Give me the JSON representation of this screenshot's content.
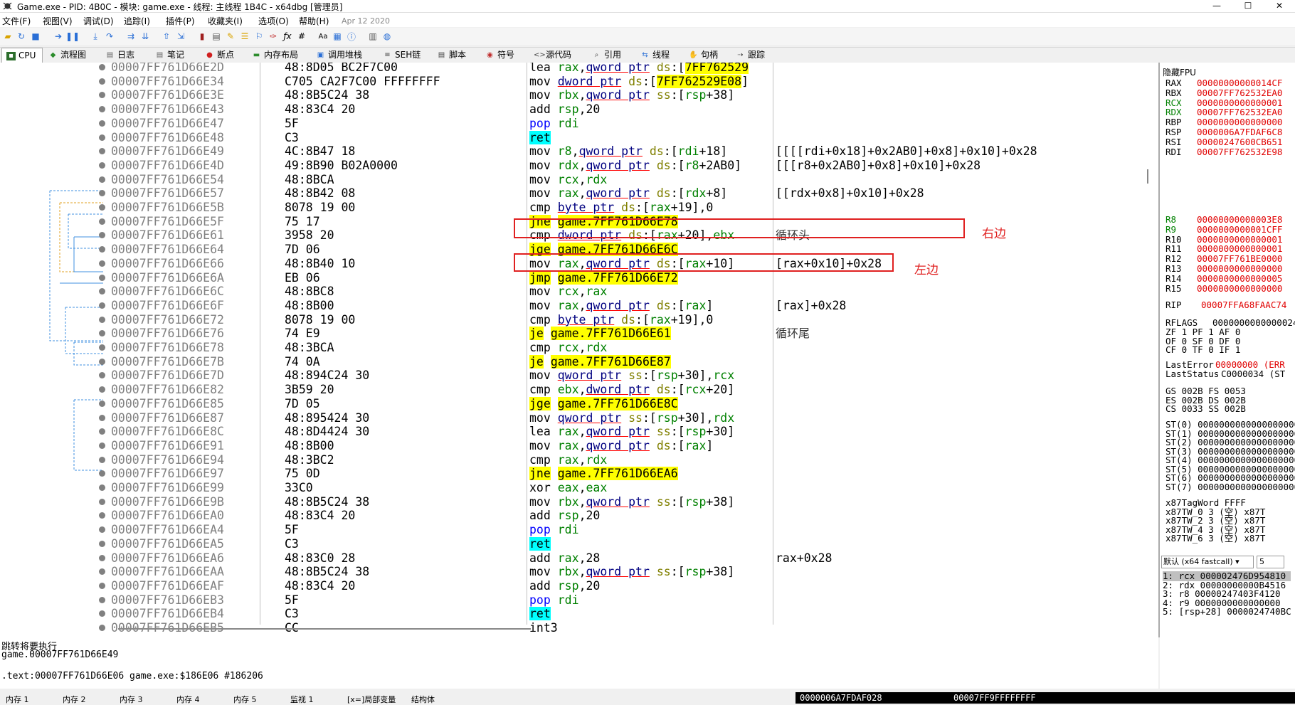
{
  "window": {
    "title": "Game.exe - PID: 4B0C - 模块: game.exe - 线程: 主线程 1B4C - x64dbg [管理员]",
    "min": "—",
    "max": "☐",
    "close": "✕"
  },
  "menu": {
    "items": [
      "文件(F)",
      "视图(V)",
      "调试(D)",
      "追踪(I)",
      "插件(P)",
      "收藏夹(I)",
      "选项(O)",
      "帮助(H)"
    ],
    "date": "Apr 12 2020"
  },
  "tabs": [
    {
      "label": "CPU",
      "icon": "cpu-icon"
    },
    {
      "label": "流程图",
      "icon": "graph-icon"
    },
    {
      "label": "日志",
      "icon": "log-icon"
    },
    {
      "label": "笔记",
      "icon": "notes-icon"
    },
    {
      "label": "断点",
      "icon": "breakpoint-icon"
    },
    {
      "label": "内存布局",
      "icon": "memory-map-icon"
    },
    {
      "label": "调用堆栈",
      "icon": "callstack-icon"
    },
    {
      "label": "SEH链",
      "icon": "seh-icon"
    },
    {
      "label": "脚本",
      "icon": "script-icon"
    },
    {
      "label": "符号",
      "icon": "symbol-icon"
    },
    {
      "label": "源代码",
      "icon": "source-icon"
    },
    {
      "label": "引用",
      "icon": "references-icon"
    },
    {
      "label": "线程",
      "icon": "threads-icon"
    },
    {
      "label": "句柄",
      "icon": "handles-icon"
    },
    {
      "label": "跟踪",
      "icon": "trace-icon"
    }
  ],
  "disasm": [
    {
      "addr": "00007FF761D66E2D",
      "bytes": "48:8D05 BC2F7C00",
      "mn": "lea",
      "ops": "rax,qword ptr ds:[7FF762529",
      "cmt": ""
    },
    {
      "addr": "00007FF761D66E34",
      "bytes": "C705 CA2F7C00 FFFFFFFF",
      "mn": "mov",
      "ops": "dword ptr ds:[7FF762529E08]",
      "cmt": ""
    },
    {
      "addr": "00007FF761D66E3E",
      "bytes": "48:8B5C24 38",
      "mn": "mov",
      "ops": "rbx,qword ptr ss:[rsp+38]",
      "cmt": ""
    },
    {
      "addr": "00007FF761D66E43",
      "bytes": "48:83C4 20",
      "mn": "add",
      "ops": "rsp,20",
      "cmt": ""
    },
    {
      "addr": "00007FF761D66E47",
      "bytes": "5F",
      "mn": "pop",
      "ops": "rdi",
      "cmt": ""
    },
    {
      "addr": "00007FF761D66E48",
      "bytes": "C3",
      "mn": "ret",
      "ops": "",
      "cmt": ""
    },
    {
      "addr": "00007FF761D66E49",
      "bytes": "4C:8B47 18",
      "mn": "mov",
      "ops": "r8,qword ptr ds:[rdi+18]",
      "cmt": "[[[[rdi+0x18]+0x2AB0]+0x8]+0x10]+0x28"
    },
    {
      "addr": "00007FF761D66E4D",
      "bytes": "49:8B90 B02A0000",
      "mn": "mov",
      "ops": "rdx,qword ptr ds:[r8+2AB0]",
      "cmt": "[[[r8+0x2AB0]+0x8]+0x10]+0x28"
    },
    {
      "addr": "00007FF761D66E54",
      "bytes": "48:8BCA",
      "mn": "mov",
      "ops": "rcx,rdx",
      "cmt": ""
    },
    {
      "addr": "00007FF761D66E57",
      "bytes": "48:8B42 08",
      "mn": "mov",
      "ops": "rax,qword ptr ds:[rdx+8]",
      "cmt": "[[rdx+0x8]+0x10]+0x28"
    },
    {
      "addr": "00007FF761D66E5B",
      "bytes": "8078 19 00",
      "mn": "cmp",
      "ops": "byte ptr ds:[rax+19],0",
      "cmt": ""
    },
    {
      "addr": "00007FF761D66E5F",
      "bytes": "75 17",
      "mn": "jne",
      "ops": "game.7FF761D66E78",
      "cmt": ""
    },
    {
      "addr": "00007FF761D66E61",
      "bytes": "3958 20",
      "mn": "cmp",
      "ops": "dword ptr ds:[rax+20],ebx",
      "cmt": "循环头"
    },
    {
      "addr": "00007FF761D66E64",
      "bytes": "7D 06",
      "mn": "jge",
      "ops": "game.7FF761D66E6C",
      "cmt": ""
    },
    {
      "addr": "00007FF761D66E66",
      "bytes": "48:8B40 10",
      "mn": "mov",
      "ops": "rax,qword ptr ds:[rax+10]",
      "cmt": "[rax+0x10]+0x28"
    },
    {
      "addr": "00007FF761D66E6A",
      "bytes": "EB 06",
      "mn": "jmp",
      "ops": "game.7FF761D66E72",
      "cmt": ""
    },
    {
      "addr": "00007FF761D66E6C",
      "bytes": "48:8BC8",
      "mn": "mov",
      "ops": "rcx,rax",
      "cmt": ""
    },
    {
      "addr": "00007FF761D66E6F",
      "bytes": "48:8B00",
      "mn": "mov",
      "ops": "rax,qword ptr ds:[rax]",
      "cmt": "[rax]+0x28"
    },
    {
      "addr": "00007FF761D66E72",
      "bytes": "8078 19 00",
      "mn": "cmp",
      "ops": "byte ptr ds:[rax+19],0",
      "cmt": ""
    },
    {
      "addr": "00007FF761D66E76",
      "bytes": "74 E9",
      "mn": "je",
      "ops": "game.7FF761D66E61",
      "cmt": "循环尾"
    },
    {
      "addr": "00007FF761D66E78",
      "bytes": "48:3BCA",
      "mn": "cmp",
      "ops": "rcx,rdx",
      "cmt": ""
    },
    {
      "addr": "00007FF761D66E7B",
      "bytes": "74 0A",
      "mn": "je",
      "ops": "game.7FF761D66E87",
      "cmt": ""
    },
    {
      "addr": "00007FF761D66E7D",
      "bytes": "48:894C24 30",
      "mn": "mov",
      "ops": "qword ptr ss:[rsp+30],rcx",
      "cmt": ""
    },
    {
      "addr": "00007FF761D66E82",
      "bytes": "3B59 20",
      "mn": "cmp",
      "ops": "ebx,dword ptr ds:[rcx+20]",
      "cmt": ""
    },
    {
      "addr": "00007FF761D66E85",
      "bytes": "7D 05",
      "mn": "jge",
      "ops": "game.7FF761D66E8C",
      "cmt": ""
    },
    {
      "addr": "00007FF761D66E87",
      "bytes": "48:895424 30",
      "mn": "mov",
      "ops": "qword ptr ss:[rsp+30],rdx",
      "cmt": ""
    },
    {
      "addr": "00007FF761D66E8C",
      "bytes": "48:8D4424 30",
      "mn": "lea",
      "ops": "rax,qword ptr ss:[rsp+30]",
      "cmt": ""
    },
    {
      "addr": "00007FF761D66E91",
      "bytes": "48:8B00",
      "mn": "mov",
      "ops": "rax,qword ptr ds:[rax]",
      "cmt": ""
    },
    {
      "addr": "00007FF761D66E94",
      "bytes": "48:3BC2",
      "mn": "cmp",
      "ops": "rax,rdx",
      "cmt": ""
    },
    {
      "addr": "00007FF761D66E97",
      "bytes": "75 0D",
      "mn": "jne",
      "ops": "game.7FF761D66EA6",
      "cmt": ""
    },
    {
      "addr": "00007FF761D66E99",
      "bytes": "33C0",
      "mn": "xor",
      "ops": "eax,eax",
      "cmt": ""
    },
    {
      "addr": "00007FF761D66E9B",
      "bytes": "48:8B5C24 38",
      "mn": "mov",
      "ops": "rbx,qword ptr ss:[rsp+38]",
      "cmt": ""
    },
    {
      "addr": "00007FF761D66EA0",
      "bytes": "48:83C4 20",
      "mn": "add",
      "ops": "rsp,20",
      "cmt": ""
    },
    {
      "addr": "00007FF761D66EA4",
      "bytes": "5F",
      "mn": "pop",
      "ops": "rdi",
      "cmt": ""
    },
    {
      "addr": "00007FF761D66EA5",
      "bytes": "C3",
      "mn": "ret",
      "ops": "",
      "cmt": ""
    },
    {
      "addr": "00007FF761D66EA6",
      "bytes": "48:83C0 28",
      "mn": "add",
      "ops": "rax,28",
      "cmt": "rax+0x28"
    },
    {
      "addr": "00007FF761D66EAA",
      "bytes": "48:8B5C24 38",
      "mn": "mov",
      "ops": "rbx,qword ptr ss:[rsp+38]",
      "cmt": ""
    },
    {
      "addr": "00007FF761D66EAF",
      "bytes": "48:83C4 20",
      "mn": "add",
      "ops": "rsp,20",
      "cmt": ""
    },
    {
      "addr": "00007FF761D66EB3",
      "bytes": "5F",
      "mn": "pop",
      "ops": "rdi",
      "cmt": ""
    },
    {
      "addr": "00007FF761D66EB4",
      "bytes": "C3",
      "mn": "ret",
      "ops": "",
      "cmt": ""
    },
    {
      "addr": "00007FF761D66EB5",
      "bytes": "CC",
      "mn": "int3",
      "ops": "",
      "cmt": ""
    }
  ],
  "annotations": {
    "right": "右边",
    "left": "左边"
  },
  "registers": {
    "header": "隐藏FPU",
    "gp": [
      {
        "n": "RAX",
        "v": "00000000000014CF"
      },
      {
        "n": "RBX",
        "v": "00007FF762532EA0"
      },
      {
        "n": "RCX",
        "v": "0000000000000001"
      },
      {
        "n": "RDX",
        "v": "00007FF762532EA0"
      },
      {
        "n": "RBP",
        "v": "0000000000000000"
      },
      {
        "n": "RSP",
        "v": "0000006A7FDAF6C8"
      },
      {
        "n": "RSI",
        "v": "00000247600CB651"
      },
      {
        "n": "RDI",
        "v": "00007FF762532E98"
      }
    ],
    "ext": [
      {
        "n": "R8",
        "v": "00000000000003E8"
      },
      {
        "n": "R9",
        "v": "0000000000001CFF"
      },
      {
        "n": "R10",
        "v": "0000000000000001"
      },
      {
        "n": "R11",
        "v": "0000000000000001"
      },
      {
        "n": "R12",
        "v": "00007FF761BE0000"
      },
      {
        "n": "R13",
        "v": "0000000000000000"
      },
      {
        "n": "R14",
        "v": "0000000000000005"
      },
      {
        "n": "R15",
        "v": "0000000000000000"
      }
    ],
    "rip": {
      "n": "RIP",
      "v": "00007FFA68FAAC74"
    },
    "rflags": {
      "n": "RFLAGS",
      "v": "0000000000000024"
    },
    "flags": [
      "ZF 1  PF 1  AF 0",
      "OF 0  SF 0  DF 0",
      "CF 0  TF 0  IF 1"
    ],
    "lasterror": {
      "n": "LastError",
      "v": "00000000 (ERR"
    },
    "laststatus": {
      "n": "LastStatus",
      "v": "C0000034 (ST"
    },
    "segs": [
      "GS 002B  FS 0053",
      "ES 002B  DS 002B",
      "CS 0033  SS 002B"
    ],
    "st": [
      "ST(0) 0000000000000000000",
      "ST(1) 0000000000000000000",
      "ST(2) 0000000000000000000",
      "ST(3) 0000000000000000000",
      "ST(4) 0000000000000000000",
      "ST(5) 0000000000000000000",
      "ST(6) 0000000000000000000",
      "ST(7) 0000000000000000000"
    ],
    "tag": [
      "x87TagWord FFFF",
      "x87TW_0 3 (空)      x87T",
      "x87TW_2 3 (空)      x87T",
      "x87TW_4 3 (空)      x87T",
      "x87TW_6 3 (空)      x87T"
    ]
  },
  "callconv": {
    "select": "默认 (x64 fastcall)",
    "count": "5",
    "lines": [
      "1: rcx 000002476D954810",
      "2: rdx 00000000000B4516",
      "3: r8 00000247403F4120",
      "4: r9 0000000000000000",
      "5: [rsp+28] 0000024740BC"
    ]
  },
  "info": {
    "line1": "跳转将要执行",
    "line2": "game.00007FF761D66E49",
    "line3": ".text:00007FF761D66E06 game.exe:$186E06 #186206"
  },
  "bottom": {
    "tabs": [
      "内存 1",
      "内存 2",
      "内存 3",
      "内存 4",
      "内存 5",
      "监视 1",
      "[x=]局部变量",
      "结构体"
    ],
    "rsp_box": "0000006A7FDAF028",
    "val_box": "00007FF9FFFFFFFF"
  }
}
